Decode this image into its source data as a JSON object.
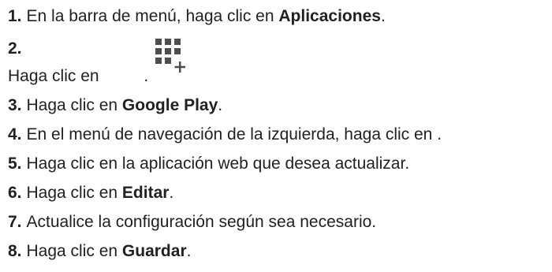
{
  "steps": [
    {
      "num": "1.",
      "parts": [
        "En la barra de menú, haga clic en ",
        "Aplicaciones",
        "."
      ]
    },
    {
      "num": "2.",
      "parts": [
        "Haga clic en ",
        "."
      ],
      "icon": "apps-add-icon"
    },
    {
      "num": "3.",
      "parts": [
        "Haga clic en ",
        "Google Play",
        "."
      ]
    },
    {
      "num": "4.",
      "parts": [
        "En el menú de navegación de la izquierda, haga clic en ."
      ]
    },
    {
      "num": "5.",
      "parts": [
        "Haga clic en la aplicación web que desea actualizar."
      ]
    },
    {
      "num": "6.",
      "parts": [
        "Haga clic en ",
        "Editar",
        "."
      ]
    },
    {
      "num": "7.",
      "parts": [
        "Actualice la configuración según sea necesario."
      ]
    },
    {
      "num": "8.",
      "parts": [
        "Haga clic en ",
        "Guardar",
        "."
      ]
    }
  ],
  "colors": {
    "text": "#212121",
    "icon": "#4d4d4d"
  }
}
